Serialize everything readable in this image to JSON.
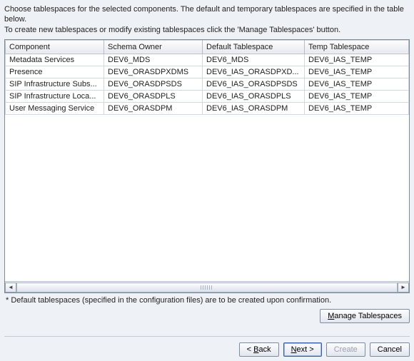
{
  "intro": {
    "line1": "Choose tablespaces for the selected components. The default and temporary tablespaces are specified in the table below.",
    "line2": "To create new tablespaces or modify existing tablespaces click the 'Manage Tablespaces' button."
  },
  "table": {
    "headers": {
      "component": "Component",
      "owner": "Schema Owner",
      "default_ts": "Default Tablespace",
      "temp_ts": "Temp Tablespace"
    },
    "rows": [
      {
        "component": "Metadata Services",
        "owner": "DEV6_MDS",
        "default_ts": "DEV6_MDS",
        "temp_ts": "DEV6_IAS_TEMP"
      },
      {
        "component": "Presence",
        "owner": "DEV6_ORASDPXDMS",
        "default_ts": "DEV6_IAS_ORASDPXD...",
        "temp_ts": "DEV6_IAS_TEMP"
      },
      {
        "component": "SIP Infrastructure Subs...",
        "owner": "DEV6_ORASDPSDS",
        "default_ts": "DEV6_IAS_ORASDPSDS",
        "temp_ts": "DEV6_IAS_TEMP"
      },
      {
        "component": "SIP Infrastructure Loca...",
        "owner": "DEV6_ORASDPLS",
        "default_ts": "DEV6_IAS_ORASDPLS",
        "temp_ts": "DEV6_IAS_TEMP"
      },
      {
        "component": "User Messaging Service",
        "owner": "DEV6_ORASDPM",
        "default_ts": "DEV6_IAS_ORASDPM",
        "temp_ts": "DEV6_IAS_TEMP"
      }
    ]
  },
  "footnote": "* Default tablespaces (specified in the configuration files) are to be created upon confirmation.",
  "buttons": {
    "manage": "Manage Tablespaces",
    "back": "Back",
    "next": "Next",
    "create": "Create",
    "cancel": "Cancel"
  },
  "mnemonic": {
    "manage": "M",
    "back": "B",
    "next": "N",
    "create": "C"
  }
}
